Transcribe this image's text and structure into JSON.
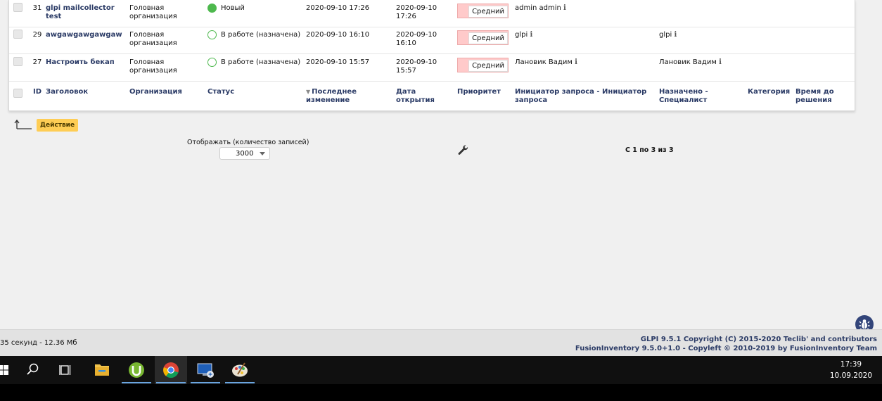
{
  "tickets": [
    {
      "id": "31",
      "title": "glpi mailcollector test",
      "org": "Головная организация",
      "status": "Новый",
      "status_type": "new",
      "modified": "2020-09-10 17:26",
      "opened": "2020-09-10 17:26",
      "priority": "Средний",
      "requester": "admin admin",
      "assigned": ""
    },
    {
      "id": "29",
      "title": "awgawgawgawgaw",
      "org": "Головная организация",
      "status": "В работе (назначена)",
      "status_type": "work",
      "modified": "2020-09-10 16:10",
      "opened": "2020-09-10 16:10",
      "priority": "Средний",
      "requester": "glpi",
      "assigned": "glpi"
    },
    {
      "id": "27",
      "title": "Настроить бекап",
      "org": "Головная организация",
      "status": "В работе (назначена)",
      "status_type": "work",
      "modified": "2020-09-10 15:57",
      "opened": "2020-09-10 15:57",
      "priority": "Средний",
      "requester": "Лановик Вадим",
      "assigned": "Лановик Вадим"
    }
  ],
  "columns": {
    "id": "ID",
    "title": "Заголовок",
    "org": "Организация",
    "status": "Статус",
    "modified": "Последнее изменение",
    "opened": "Дата открытия",
    "priority": "Приоритет",
    "requester": "Инициатор запроса - Инициатор запроса",
    "assigned": "Назначено - Специалист",
    "category": "Категория",
    "solve_time": "Время до решения"
  },
  "colors": {
    "status_new": "#4db84d",
    "priority_medium": "#ffcaca",
    "link": "#2b3b66",
    "action": "#fecd55"
  },
  "actions": {
    "action_label": "Действие"
  },
  "pagination": {
    "per_page_label": "Отображать (количество записей)",
    "per_page_value": "3000",
    "range_text": "С 1 по 3 из 3"
  },
  "footer": {
    "timing": "35 секунд - 12.36 Мб",
    "copyright_line1": "GLPI 9.5.1 Copyright (C) 2015-2020 Teclib' and contributors",
    "copyright_line2": "FusionInventory 9.5.0+1.0 - Copyleft © 2010-2019 by FusionInventory Team"
  },
  "taskbar": {
    "icons": [
      "windows-start-icon",
      "search-icon",
      "task-view-icon",
      "file-explorer-icon",
      "utorrent-icon",
      "chrome-icon",
      "remote-desktop-icon",
      "paint-icon"
    ],
    "time": "17:39",
    "date": "10.09.2020"
  }
}
